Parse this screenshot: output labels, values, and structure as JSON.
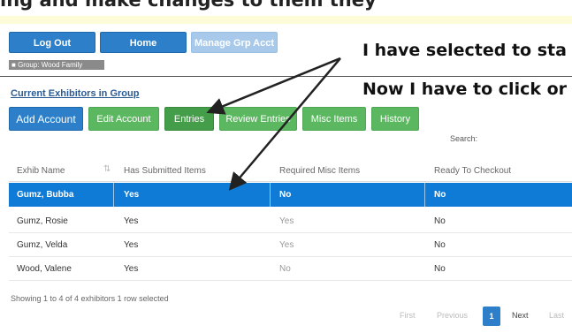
{
  "top_caption": "ing  and make changes to them  they",
  "buttons": {
    "logout": "Log Out",
    "home": "Home",
    "manage_grp": "Manage Grp Acct"
  },
  "group": {
    "label": "Group: Wood Family"
  },
  "section_title": "Current Exhibitors in Group",
  "actions": {
    "add_account": "Add Account",
    "edit_account": "Edit Account",
    "entries": "Entries",
    "review_entries": "Review Entries",
    "misc_items": "Misc Items",
    "history": "History"
  },
  "annotations": {
    "line1": "I have selected to sta",
    "line2": "Now I have to click or"
  },
  "search": {
    "label": "Search:"
  },
  "table": {
    "columns": [
      "Exhib Name",
      "Has Submitted Items",
      "Required Misc Items",
      "Ready To Checkout"
    ],
    "rows": [
      {
        "name": "Gumz, Bubba",
        "submitted": "Yes",
        "misc": "No",
        "ready": "No",
        "selected": true
      },
      {
        "name": "Gumz, Rosie",
        "submitted": "Yes",
        "misc": "Yes",
        "ready": "No",
        "selected": false
      },
      {
        "name": "Gumz, Velda",
        "submitted": "Yes",
        "misc": "Yes",
        "ready": "No",
        "selected": false
      },
      {
        "name": "Wood, Valene",
        "submitted": "Yes",
        "misc": "No",
        "ready": "No",
        "selected": false
      }
    ]
  },
  "footer": {
    "info": "Showing 1 to 4 of 4 exhibitors   1 row selected"
  },
  "pagination": {
    "first": "First",
    "previous": "Previous",
    "current": "1",
    "next": "Next",
    "last": "Last"
  },
  "colors": {
    "primary_blue": "#2c7fc8",
    "selected_row": "#0f7bd6",
    "green": "#5cb860",
    "section_link": "#2a5b93"
  }
}
